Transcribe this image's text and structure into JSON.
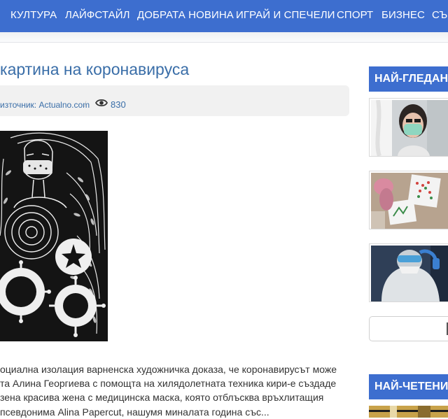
{
  "nav": {
    "items": [
      "КУЛТУРА",
      "ЛАЙФСТАЙЛ",
      "ДОБРАТА НОВИНА",
      "ИГРАЙ И СПЕЧЕЛИ",
      "СПОРТ",
      "БИЗНЕС",
      "СЪ"
    ]
  },
  "article": {
    "title": "картина на коронавируса",
    "source": "източник: Actualno.com",
    "separator": "/",
    "views": "830",
    "views_icon": "eye-icon",
    "image_icon": "papercut-artwork-image",
    "excerpt_lines": [
      "оциална изолация варненска художничка доказа, че коронавирусът може",
      "та Алина Георгиева с помощта на хилядолетната техника кири-е създаде",
      "зена красива жена с медицинска маска, която отблъсква връхлитащия",
      "псевдонима Alina Papercut, нашумя миналата година със..."
    ]
  },
  "sidebar": {
    "most_viewed_heading": "НАЙ-ГЛЕДАНИ",
    "most_read_heading": "НАЙ-ЧЕТЕНИ",
    "thumbnails": [
      "woman-mask-thumbnail",
      "child-drawing-thumbnail",
      "protective-suit-thumbnail"
    ]
  },
  "colors": {
    "nav_bg": "#3d6ecf",
    "link": "#3a6ea8",
    "meta_bg": "#f1f1f1"
  }
}
